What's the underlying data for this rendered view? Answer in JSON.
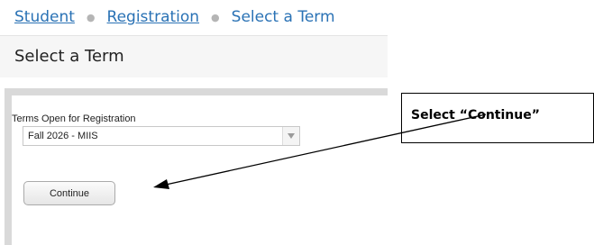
{
  "breadcrumb": {
    "items": [
      "Student",
      "Registration"
    ],
    "current": "Select a Term"
  },
  "page": {
    "title": "Select a Term"
  },
  "form": {
    "terms_label": "Terms Open for Registration",
    "term_selected": "Fall 2026 - MIIS",
    "continue_label": "Continue"
  },
  "annotation": {
    "text": "Select “Continue”"
  },
  "colors": {
    "link": "#2a72b5",
    "panel_border": "#d9d9d9",
    "title_bar": "#f6f6f6"
  },
  "icons": {
    "select_arrow": "chevron-down-icon",
    "separator": "bullet-separator-icon"
  }
}
